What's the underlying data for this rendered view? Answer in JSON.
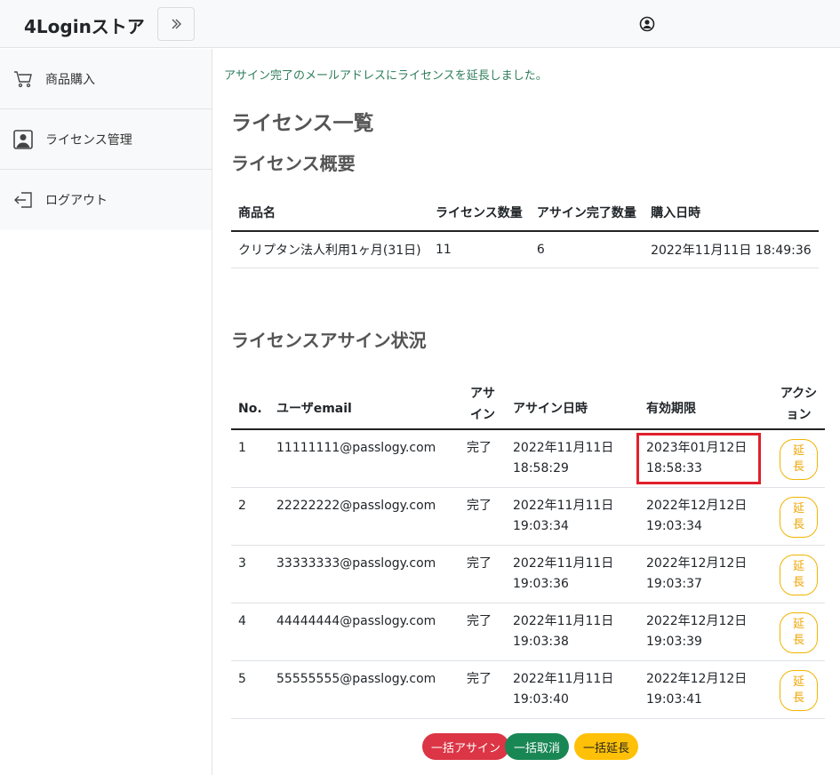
{
  "app": {
    "brand": "4Loginストア",
    "toggle_icon": "chevron-double-right-icon"
  },
  "sidebar": {
    "items": [
      {
        "label": "商品購入",
        "icon": "cart-icon"
      },
      {
        "label": "ライセンス管理",
        "icon": "person-badge-icon"
      },
      {
        "label": "ログアウト",
        "icon": "logout-icon"
      }
    ]
  },
  "main": {
    "alert": "アサイン完了のメールアドレスにライセンスを延長しました。",
    "title": "ライセンス一覧",
    "summary_title": "ライセンス概要",
    "summary_table": {
      "headers": [
        "商品名",
        "ライセンス数量",
        "アサイン完了数量",
        "購入日時"
      ],
      "row": [
        "クリプタン法人利用1ヶ月(31日)",
        "11",
        "6",
        "2022年11月11日 18:49:36"
      ]
    },
    "assign_title": "ライセンスアサイン状況",
    "assign_table": {
      "headers": {
        "no": "No.",
        "email": "ユーザemail",
        "assign": "アサイン",
        "assign_date": "アサイン日時",
        "expiry": "有効期限",
        "action": "アクション"
      },
      "rows": [
        {
          "no": "1",
          "email": "11111111@passlogy.com",
          "status": "完了",
          "date1": "2022年11月11日",
          "time1": "18:58:29",
          "date2": "2023年01月12日",
          "time2": "18:58:33",
          "action": "延長"
        },
        {
          "no": "2",
          "email": "22222222@passlogy.com",
          "status": "完了",
          "date1": "2022年11月11日",
          "time1": "19:03:34",
          "date2": "2022年12月12日",
          "time2": "19:03:34",
          "action": "延長"
        },
        {
          "no": "3",
          "email": "33333333@passlogy.com",
          "status": "完了",
          "date1": "2022年11月11日",
          "time1": "19:03:36",
          "date2": "2022年12月12日",
          "time2": "19:03:37",
          "action": "延長"
        },
        {
          "no": "4",
          "email": "44444444@passlogy.com",
          "status": "完了",
          "date1": "2022年11月11日",
          "time1": "19:03:38",
          "date2": "2022年12月12日",
          "time2": "19:03:39",
          "action": "延長"
        },
        {
          "no": "5",
          "email": "55555555@passlogy.com",
          "status": "完了",
          "date1": "2022年11月11日",
          "time1": "19:03:40",
          "date2": "2022年12月12日",
          "time2": "19:03:41",
          "action": "延長"
        }
      ]
    },
    "bulk_buttons": {
      "assign": "一括アサイン",
      "cancel": "一括取消",
      "extend": "一括延長"
    }
  },
  "colors": {
    "highlight": "#e0202c",
    "danger": "#dc3545",
    "success": "#198754",
    "warning": "#ffc107"
  }
}
